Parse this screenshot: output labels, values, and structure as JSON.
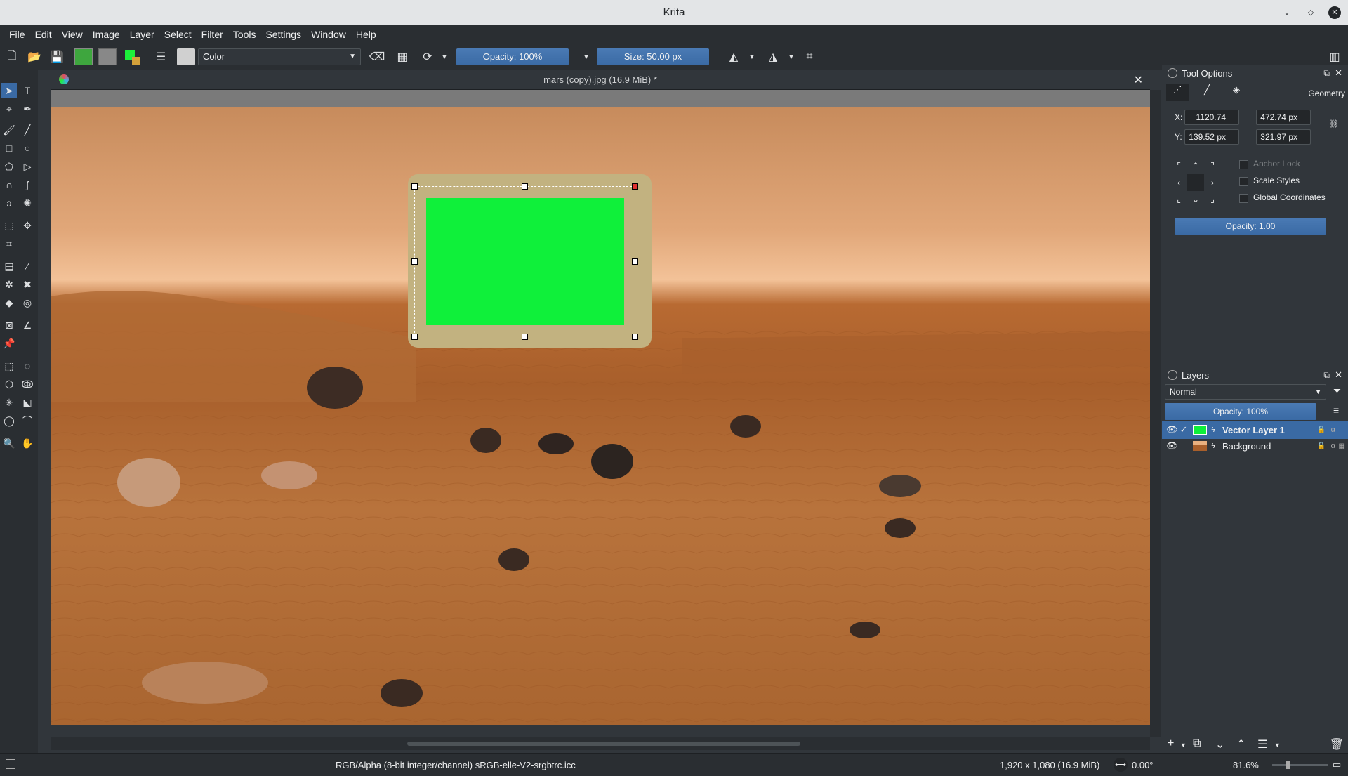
{
  "window": {
    "title": "Krita"
  },
  "menu": [
    "File",
    "Edit",
    "View",
    "Image",
    "Layer",
    "Select",
    "Filter",
    "Tools",
    "Settings",
    "Window",
    "Help"
  ],
  "toolbar": {
    "blend_mode": "Color",
    "opacity": "Opacity: 100%",
    "size": "Size: 50.00 px"
  },
  "document": {
    "tab_title": "mars (copy).jpg (16.9 MiB) *"
  },
  "tool_options": {
    "title": "Tool Options",
    "tab_label": "Geometry",
    "x_label": "X:",
    "y_label": "Y:",
    "x_value": "1120.74 px",
    "y_value": "139.52 px",
    "width_value": "472.74 px",
    "height_value": "321.97 px",
    "anchor_lock": "Anchor Lock",
    "scale_styles": "Scale Styles",
    "global_coords": "Global Coordinates",
    "opacity": "Opacity: 1.00"
  },
  "layers": {
    "title": "Layers",
    "blend": "Normal",
    "opacity": "Opacity:  100%",
    "items": [
      {
        "name": "Vector Layer 1"
      },
      {
        "name": "Background"
      }
    ]
  },
  "status": {
    "color_profile": "RGB/Alpha (8-bit integer/channel)  sRGB-elle-V2-srgbtrc.icc",
    "dimensions": "1,920 x 1,080 (16.9 MiB)",
    "rotation": "0.00°",
    "zoom": "81.6%"
  },
  "colors": {
    "selection_fill": "#c2b280",
    "green_rect": "#0ff03a",
    "accent": "#3daee9"
  }
}
